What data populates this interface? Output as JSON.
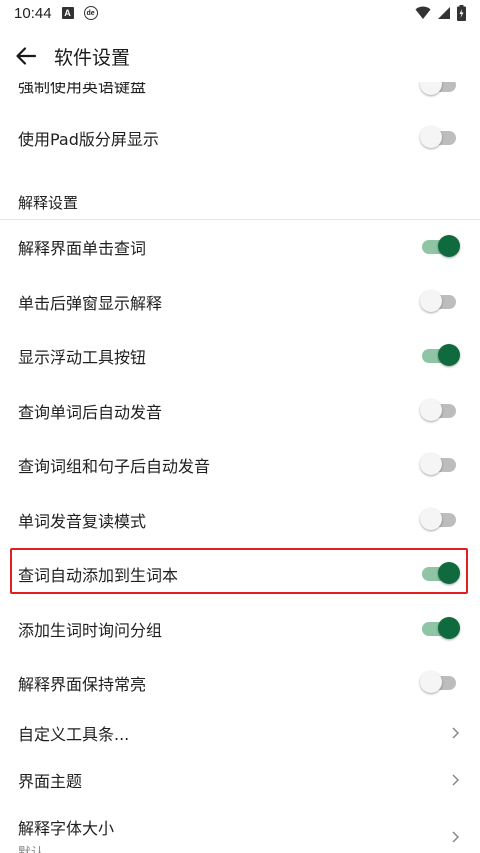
{
  "statusbar": {
    "time": "10:44",
    "a_icon_text": "A",
    "de_icon_text": "de"
  },
  "appbar": {
    "title": "软件设置"
  },
  "rows_top": [
    {
      "label": "强制使用英语键盘",
      "toggle": "off"
    },
    {
      "label": "使用Pad版分屏显示",
      "toggle": "off"
    }
  ],
  "section": {
    "header": "解释设置"
  },
  "rows": [
    {
      "label": "解释界面单击查词",
      "toggle": "on"
    },
    {
      "label": "单击后弹窗显示解释",
      "toggle": "off"
    },
    {
      "label": "显示浮动工具按钮",
      "toggle": "on"
    },
    {
      "label": "查询单词后自动发音",
      "toggle": "off"
    },
    {
      "label": "查询词组和句子后自动发音",
      "toggle": "off"
    },
    {
      "label": "单词发音复读模式",
      "toggle": "off"
    },
    {
      "label": "查词自动添加到生词本",
      "toggle": "on"
    },
    {
      "label": "添加生词时询问分组",
      "toggle": "on"
    },
    {
      "label": "解释界面保持常亮",
      "toggle": "off"
    }
  ],
  "nav_rows": [
    {
      "label": "自定义工具条..."
    },
    {
      "label": "界面主题"
    },
    {
      "label": "解释字体大小",
      "sub": "默认"
    }
  ],
  "colors": {
    "toggle_on_thumb": "#0f6b3e",
    "toggle_on_track": "#8fc4a4",
    "toggle_off_thumb": "#f5f5f5",
    "toggle_off_track": "#bdbdbd",
    "highlight": "#e02020"
  }
}
